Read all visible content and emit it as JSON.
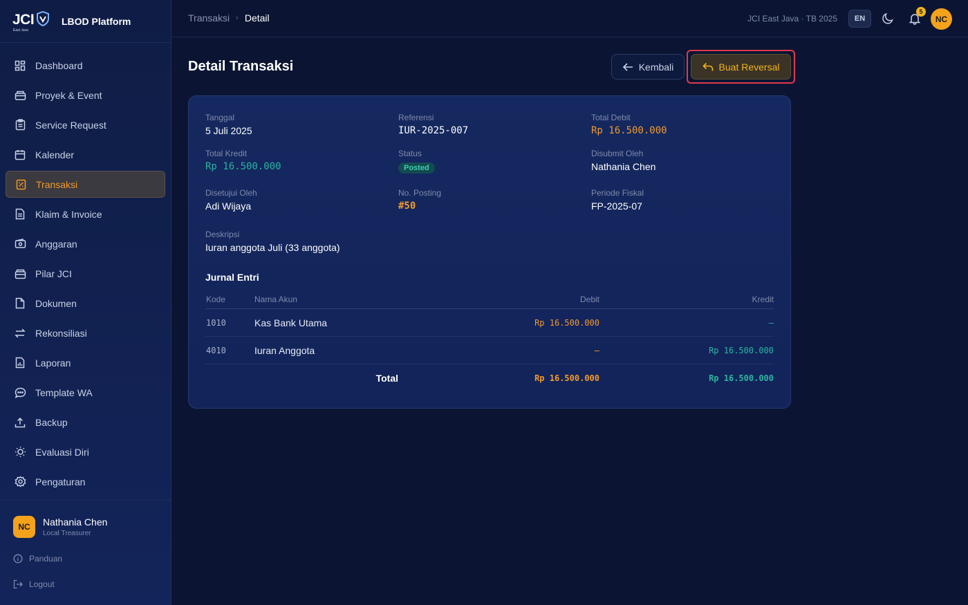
{
  "brand": {
    "logo_text": "JCI",
    "logo_sub": "East Java",
    "platform": "LBOD Platform"
  },
  "nav": [
    {
      "label": "Dashboard",
      "icon": "dashboard-icon"
    },
    {
      "label": "Proyek & Event",
      "icon": "briefcase-icon"
    },
    {
      "label": "Service Request",
      "icon": "clipboard-icon"
    },
    {
      "label": "Kalender",
      "icon": "calendar-icon"
    },
    {
      "label": "Transaksi",
      "icon": "receipt-icon",
      "active": true
    },
    {
      "label": "Klaim & Invoice",
      "icon": "file-text-icon"
    },
    {
      "label": "Anggaran",
      "icon": "wallet-icon"
    },
    {
      "label": "Pilar JCI",
      "icon": "layers-icon"
    },
    {
      "label": "Dokumen",
      "icon": "file-icon"
    },
    {
      "label": "Rekonsiliasi",
      "icon": "swap-icon"
    },
    {
      "label": "Laporan",
      "icon": "report-icon"
    },
    {
      "label": "Template WA",
      "icon": "chat-icon"
    },
    {
      "label": "Backup",
      "icon": "upload-icon"
    },
    {
      "label": "Evaluasi Diri",
      "icon": "sun-icon"
    },
    {
      "label": "Pengaturan",
      "icon": "gear-icon"
    }
  ],
  "user": {
    "initials": "NC",
    "name": "Nathania Chen",
    "role": "Local Treasurer"
  },
  "footer": {
    "guide": "Panduan",
    "logout": "Logout"
  },
  "topbar": {
    "crumb_parent": "Transaksi",
    "crumb_current": "Detail",
    "org": "JCI East Java · TB 2025",
    "lang": "EN",
    "notif_count": "5",
    "avatar": "NC"
  },
  "page": {
    "title": "Detail Transaksi",
    "back_label": "Kembali",
    "reversal_label": "Buat Reversal"
  },
  "detail": {
    "tanggal_label": "Tanggal",
    "tanggal": "5 Juli 2025",
    "referensi_label": "Referensi",
    "referensi": "IUR-2025-007",
    "total_debit_label": "Total Debit",
    "total_debit": "Rp 16.500.000",
    "total_kredit_label": "Total Kredit",
    "total_kredit": "Rp 16.500.000",
    "status_label": "Status",
    "status": "Posted",
    "submitted_label": "Disubmit Oleh",
    "submitted": "Nathania Chen",
    "approved_label": "Disetujui Oleh",
    "approved": "Adi Wijaya",
    "posting_label": "No. Posting",
    "posting": "#50",
    "periode_label": "Periode Fiskal",
    "periode": "FP-2025-07",
    "deskripsi_label": "Deskripsi",
    "deskripsi": "Iuran anggota Juli (33 anggota)"
  },
  "journal": {
    "title": "Jurnal Entri",
    "headers": {
      "code": "Kode",
      "name": "Nama Akun",
      "debit": "Debit",
      "credit": "Kredit"
    },
    "rows": [
      {
        "code": "1010",
        "name": "Kas Bank Utama",
        "debit": "Rp 16.500.000",
        "credit": "–"
      },
      {
        "code": "4010",
        "name": "Iuran Anggota",
        "debit": "–",
        "credit": "Rp 16.500.000"
      }
    ],
    "total": {
      "label": "Total",
      "debit": "Rp 16.500.000",
      "credit": "Rp 16.500.000"
    }
  },
  "colors": {
    "accent": "#f39a2b",
    "teal": "#2bb5a0",
    "background": "#0b1533"
  }
}
